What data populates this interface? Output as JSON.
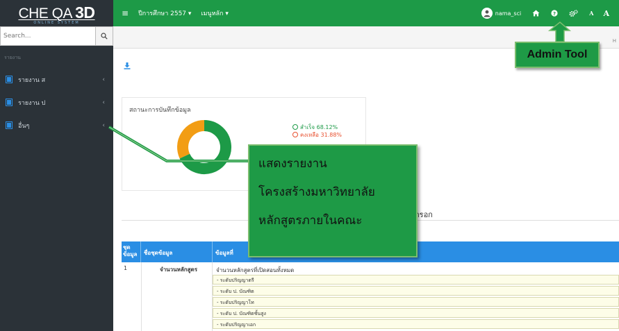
{
  "app": {
    "logo_main": "CHE QA",
    "logo_3d": "3D",
    "logo_sub": "ONLINE SYSTEM"
  },
  "sidebar": {
    "search_placeholder": "Search...",
    "nav_header": "รายงาน",
    "items": [
      {
        "label": "รายงาน ส"
      },
      {
        "label": "รายงาน ป"
      },
      {
        "label": "อื่นๆ"
      }
    ]
  },
  "topbar": {
    "year_menu": "ปีการศึกษา 2557 ▾",
    "main_menu": "เมนูหลัก ▾",
    "username": "nama_sci",
    "font_small": "A",
    "font_large": "A"
  },
  "subbar": {
    "breadcrumb": "H"
  },
  "status_card": {
    "title": "สถานะการบันทึกข้อมูล",
    "legend": [
      {
        "label": "สำเร็จ 68.12%",
        "color": "#1d9a47",
        "value": 68.12
      },
      {
        "label": "คงเหลือ 31.88%",
        "color": "#e8502f",
        "value": 31.88
      }
    ],
    "donut_colors": {
      "done": "#1d9a47",
      "remaining": "#f29d14"
    }
  },
  "section": {
    "label": "กรอก"
  },
  "table": {
    "headers": {
      "no": "ชุด ข้อมูล",
      "name": "ชื่อชุดข้อมูล",
      "field": "ข้อมูลที่"
    },
    "row": {
      "no": "1",
      "name": "จำนวนหลักสูตร",
      "main": "จำนวนหลักสูตรที่เปิดสอนทั้งหมด",
      "subs": [
        "- ระดับปริญญาตรี",
        "- ระดับ ป. บัณฑิต",
        "- ระดับปริญญาโท",
        "- ระดับ ป. บัณฑิตชั้นสูง",
        "- ระดับปริญญาเอก"
      ]
    }
  },
  "callouts": {
    "admin_tool": "Admin Tool",
    "report_lines": [
      "แสดงรายงาน",
      "โครงสร้างมหาวิทยาลัย",
      "หลักสูตรภายในคณะ"
    ]
  }
}
